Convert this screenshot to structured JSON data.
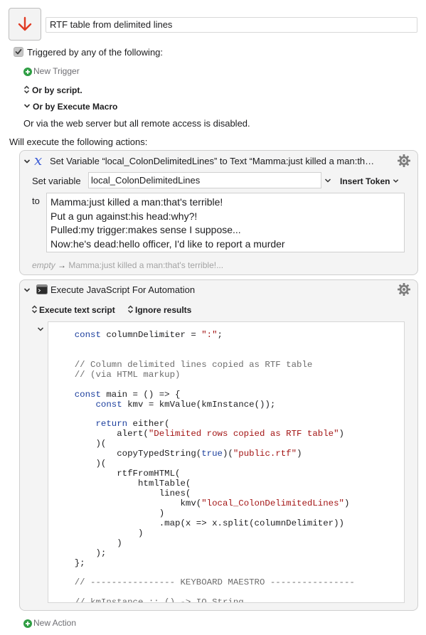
{
  "macro": {
    "name": "RTF table from delimited lines",
    "icon": "down-arrow-icon",
    "accent_color": "#e03b24"
  },
  "triggers": {
    "checkbox_label": "Triggered by any of the following:",
    "new_trigger": "New Trigger",
    "or_by_script": "Or by script.",
    "or_by_execute_macro": "Or by Execute Macro",
    "web_server_note": "Or via the web server but all remote access is disabled."
  },
  "actions_heading": "Will execute the following actions:",
  "set_variable_action": {
    "title": "Set Variable “local_ColonDelimitedLines” to Text “Mamma:just killed a man:th…",
    "set_variable_label": "Set variable",
    "variable_name": "local_ColonDelimitedLines",
    "insert_token": "Insert Token",
    "to_label": "to",
    "text_lines": [
      "Mamma:just killed a man:that's terrible!",
      "Put a gun against:his head:why?!",
      "Pulled:my trigger:makes sense I suppose...",
      "Now:he's dead:hello officer, I'd like to report a murder"
    ],
    "preview_empty": "empty",
    "preview_arrow": "→",
    "preview_text": "Mamma:just killed a man:that's terrible!..."
  },
  "jxa_action": {
    "title": "Execute JavaScript For Automation",
    "execute_option": "Execute text script",
    "results_option": "Ignore results",
    "code_lines": [
      [
        {
          "t": "    "
        },
        {
          "t": "const",
          "c": "kw"
        },
        {
          "t": " columnDelimiter = "
        },
        {
          "t": "\":\"",
          "c": "str"
        },
        {
          "t": ";"
        }
      ],
      [],
      [],
      [
        {
          "t": "    "
        },
        {
          "t": "// Column delimited lines copied as RTF table",
          "c": "cmt"
        }
      ],
      [
        {
          "t": "    "
        },
        {
          "t": "// (via HTML markup)",
          "c": "cmt"
        }
      ],
      [],
      [
        {
          "t": "    "
        },
        {
          "t": "const",
          "c": "kw"
        },
        {
          "t": " main = () => {"
        }
      ],
      [
        {
          "t": "        "
        },
        {
          "t": "const",
          "c": "kw"
        },
        {
          "t": " kmv = kmValue(kmInstance());"
        }
      ],
      [],
      [
        {
          "t": "        "
        },
        {
          "t": "return",
          "c": "kw"
        },
        {
          "t": " either("
        }
      ],
      [
        {
          "t": "            alert("
        },
        {
          "t": "\"Delimited rows copied as RTF table\"",
          "c": "str"
        },
        {
          "t": ")"
        }
      ],
      [
        {
          "t": "        )("
        }
      ],
      [
        {
          "t": "            copyTypedString("
        },
        {
          "t": "true",
          "c": "kw"
        },
        {
          "t": ")("
        },
        {
          "t": "\"public.rtf\"",
          "c": "str"
        },
        {
          "t": ")"
        }
      ],
      [
        {
          "t": "        )("
        }
      ],
      [
        {
          "t": "            rtfFromHTML("
        }
      ],
      [
        {
          "t": "                htmlTable("
        }
      ],
      [
        {
          "t": "                    lines("
        }
      ],
      [
        {
          "t": "                        kmv("
        },
        {
          "t": "\"local_ColonDelimitedLines\"",
          "c": "str"
        },
        {
          "t": ")"
        }
      ],
      [
        {
          "t": "                    )"
        }
      ],
      [
        {
          "t": "                    .map(x => x.split(columnDelimiter))"
        }
      ],
      [
        {
          "t": "                )"
        }
      ],
      [
        {
          "t": "            )"
        }
      ],
      [
        {
          "t": "        );"
        }
      ],
      [
        {
          "t": "    };"
        }
      ],
      [],
      [
        {
          "t": "    "
        },
        {
          "t": "// ---------------- KEYBOARD MAESTRO ----------------",
          "c": "cmt"
        }
      ],
      [],
      [
        {
          "t": "    "
        },
        {
          "t": "// kmInstance :: () -> IO String",
          "c": "cmt"
        }
      ]
    ]
  },
  "new_action": "New Action"
}
